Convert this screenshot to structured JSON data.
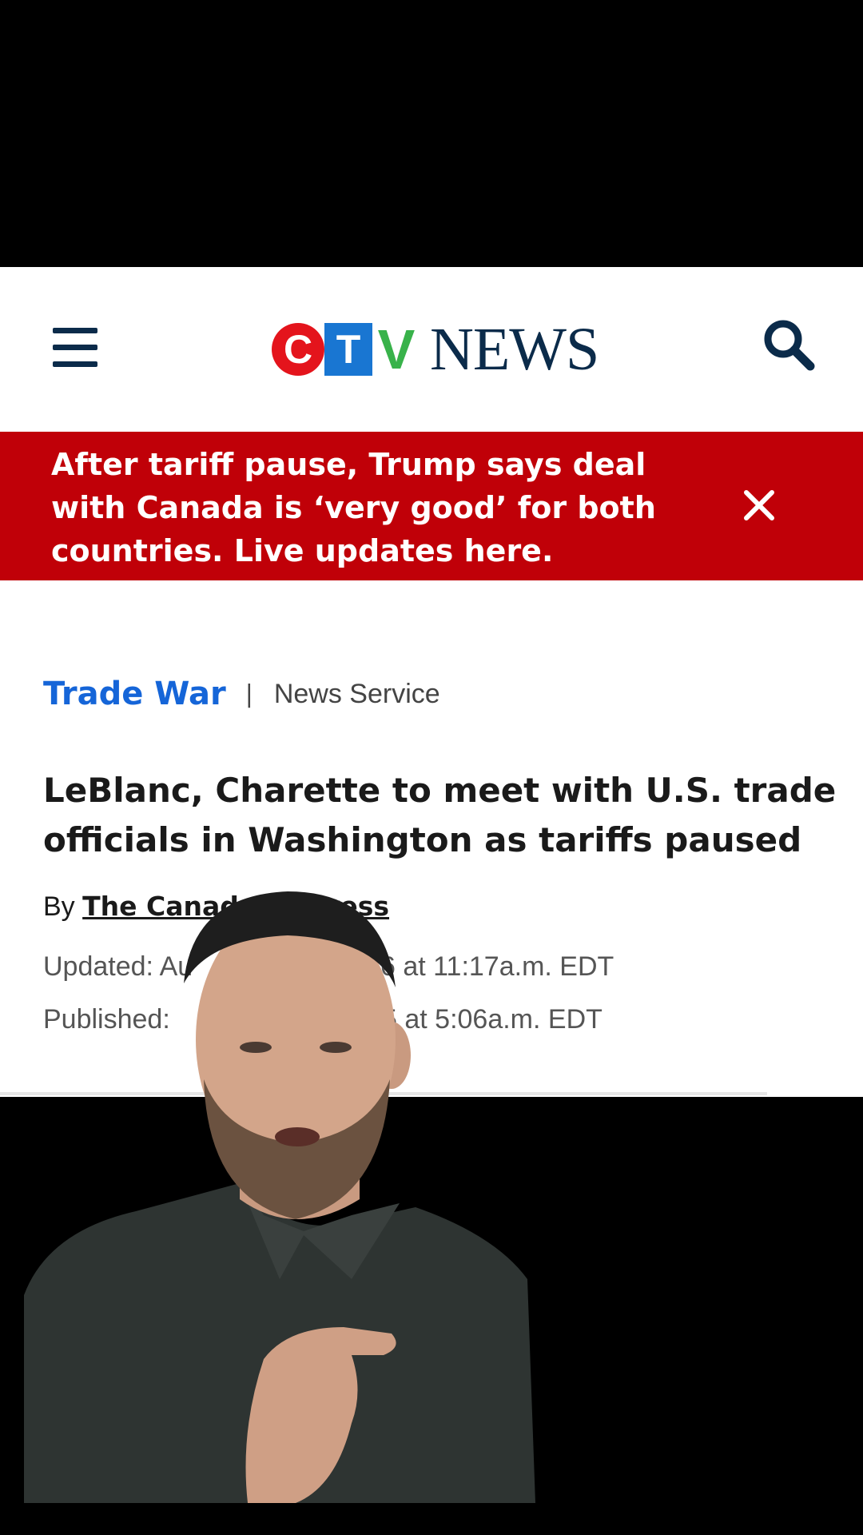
{
  "header": {
    "logo_letters": [
      "C",
      "T",
      "V"
    ],
    "logo_word": "NEWS",
    "brand_colors": {
      "c": "#e4141c",
      "t": "#1976d2",
      "v": "#38b24a",
      "navy": "#0b2b4a"
    }
  },
  "alert_banner": {
    "text": "After tariff pause, Trump says deal with Canada is ‘very good’ for both countries. Live updates here.",
    "color": "#c00008"
  },
  "article": {
    "section": "Trade War",
    "separator": "|",
    "source_type": "News Service",
    "headline": "LeBlanc, Charette to meet with U.S. trade officials in Washington as tariffs paused",
    "byline_prefix": "By",
    "author_visible_start": "The Canad",
    "author_visible_end": "Press",
    "updated_prefix": "Updated: Au",
    "updated_suffix": "6 at 11:17a.m. EDT",
    "published_prefix": "Published:",
    "published_suffix": "5 at 5:06a.m. EDT"
  },
  "icons": [
    "menu-icon",
    "search-icon",
    "close-icon"
  ]
}
